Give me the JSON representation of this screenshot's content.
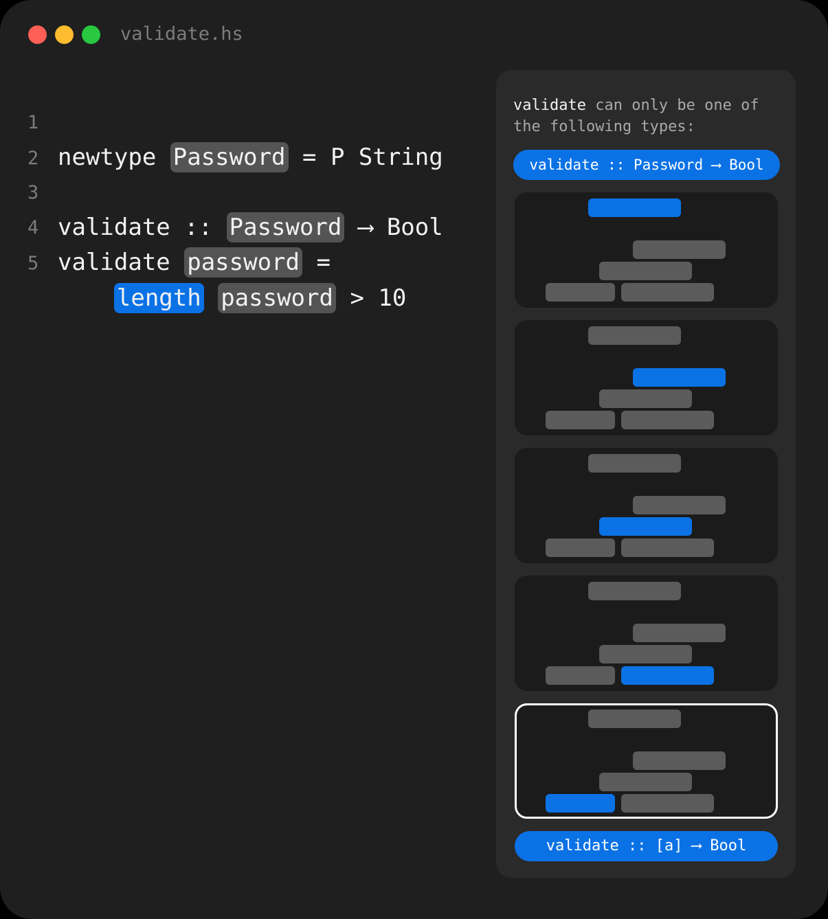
{
  "window": {
    "title": "validate.hs",
    "traffic_lights": [
      "close",
      "minimize",
      "maximize"
    ]
  },
  "code": {
    "line_numbers": [
      "1",
      "2",
      "3",
      "4",
      "5"
    ],
    "line1": {
      "kw": "newtype ",
      "tok": "Password",
      "rest": " = P String"
    },
    "line3": {
      "pre": "validate :: ",
      "tok": "Password",
      "rest": " ⟶ Bool"
    },
    "line4": {
      "pre": "validate ",
      "tok": "password",
      "rest": " ="
    },
    "line5": {
      "indent": "    ",
      "tok_blue": "length",
      "tok": "password",
      "rest": " > 10"
    }
  },
  "panel": {
    "desc_keyword": "validate",
    "desc_text": " can only be one of the following types:",
    "top_type": "validate :: Password ⟶ Bool",
    "bottom_type": "validate :: [a] ⟶ Bool",
    "cards": [
      {
        "highlighted": "root",
        "selected": false
      },
      {
        "highlighted": "middle",
        "selected": false
      },
      {
        "highlighted": "lower",
        "selected": false
      },
      {
        "highlighted": "bottom-right",
        "selected": false
      },
      {
        "highlighted": "bottom-left",
        "selected": true
      }
    ]
  },
  "colors": {
    "background": "#1f1f1f",
    "accent_blue": "#0b72e6",
    "token_gray": "#545454"
  }
}
